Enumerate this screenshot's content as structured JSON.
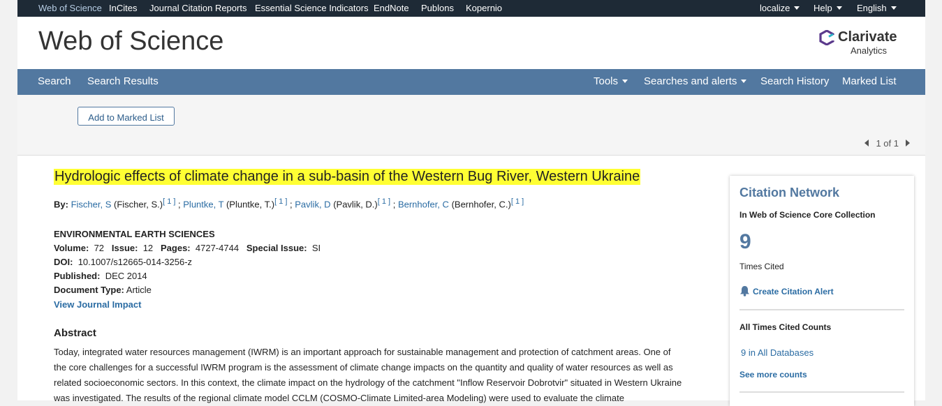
{
  "topbar": {
    "products": [
      "Web of Science",
      "InCites",
      "Journal Citation Reports",
      "Essential Science Indicators",
      "EndNote",
      "Publons",
      "Kopernio"
    ],
    "localize": "localize",
    "help": "Help",
    "language": "English"
  },
  "header": {
    "brand": "Web of Science",
    "logo_name": "Clarivate",
    "logo_sub": "Analytics"
  },
  "nav": {
    "search": "Search",
    "search_results": "Search Results",
    "tools": "Tools",
    "searches_alerts": "Searches and alerts",
    "search_history": "Search History",
    "marked_list": "Marked List"
  },
  "toolbar": {
    "add_marked": "Add to Marked List",
    "pager": "1 of 1"
  },
  "record": {
    "title": "Hydrologic effects of climate change in a sub-basin of the Western Bug River, Western Ukraine",
    "by_label": "By:",
    "authors": [
      {
        "link": "Fischer, S",
        "full": "(Fischer, S.)",
        "ref": "[ 1 ]"
      },
      {
        "link": "Pluntke, T",
        "full": "(Pluntke, T.)",
        "ref": "[ 1 ]"
      },
      {
        "link": "Pavlik, D",
        "full": "(Pavlik, D.)",
        "ref": "[ 1 ]"
      },
      {
        "link": "Bernhofer, C",
        "full": "(Bernhofer, C.)",
        "ref": "[ 1 ]"
      }
    ],
    "journal": "ENVIRONMENTAL EARTH SCIENCES",
    "volume_label": "Volume:",
    "volume": "72",
    "issue_label": "Issue:",
    "issue": "12",
    "pages_label": "Pages:",
    "pages": "4727-4744",
    "special_label": "Special Issue:",
    "special": "SI",
    "doi_label": "DOI:",
    "doi": "10.1007/s12665-014-3256-z",
    "published_label": "Published:",
    "published": "DEC 2014",
    "doctype_label": "Document Type:",
    "doctype": "Article",
    "journal_impact": "View Journal Impact",
    "abstract_heading": "Abstract",
    "abstract": "Today, integrated water resources management (IWRM) is an important approach for sustainable management and protection of catchment areas. One of the core challenges for a successful IWRM program is the assessment of climate change impacts on the quantity and quality of water resources as well as related socioeconomic sectors. In this context, the climate impact on the hydrology of the catchment \"Inflow Reservoir Dobrotvir\" situated in Western Ukraine was investigated. The results of the regional climate model CCLM (COSMO-Climate Limited-area Modeling) were used to evaluate the climate"
  },
  "citation": {
    "title": "Citation Network",
    "collection": "In Web of Science Core Collection",
    "times_cited": "9",
    "times_cited_label": "Times Cited",
    "alert": "Create Citation Alert",
    "all_counts": "All Times Cited Counts",
    "all_db": "9 in All Databases",
    "more": "See more counts"
  },
  "colors": {
    "topbar": "#1e2a36",
    "nav": "#5278a0",
    "link": "#2b6ca3",
    "highlight": "#ffff33"
  },
  "icons": [
    "caret-down-icon",
    "clarivate-logo-icon",
    "prev-arrow-icon",
    "next-arrow-icon",
    "bell-icon"
  ]
}
